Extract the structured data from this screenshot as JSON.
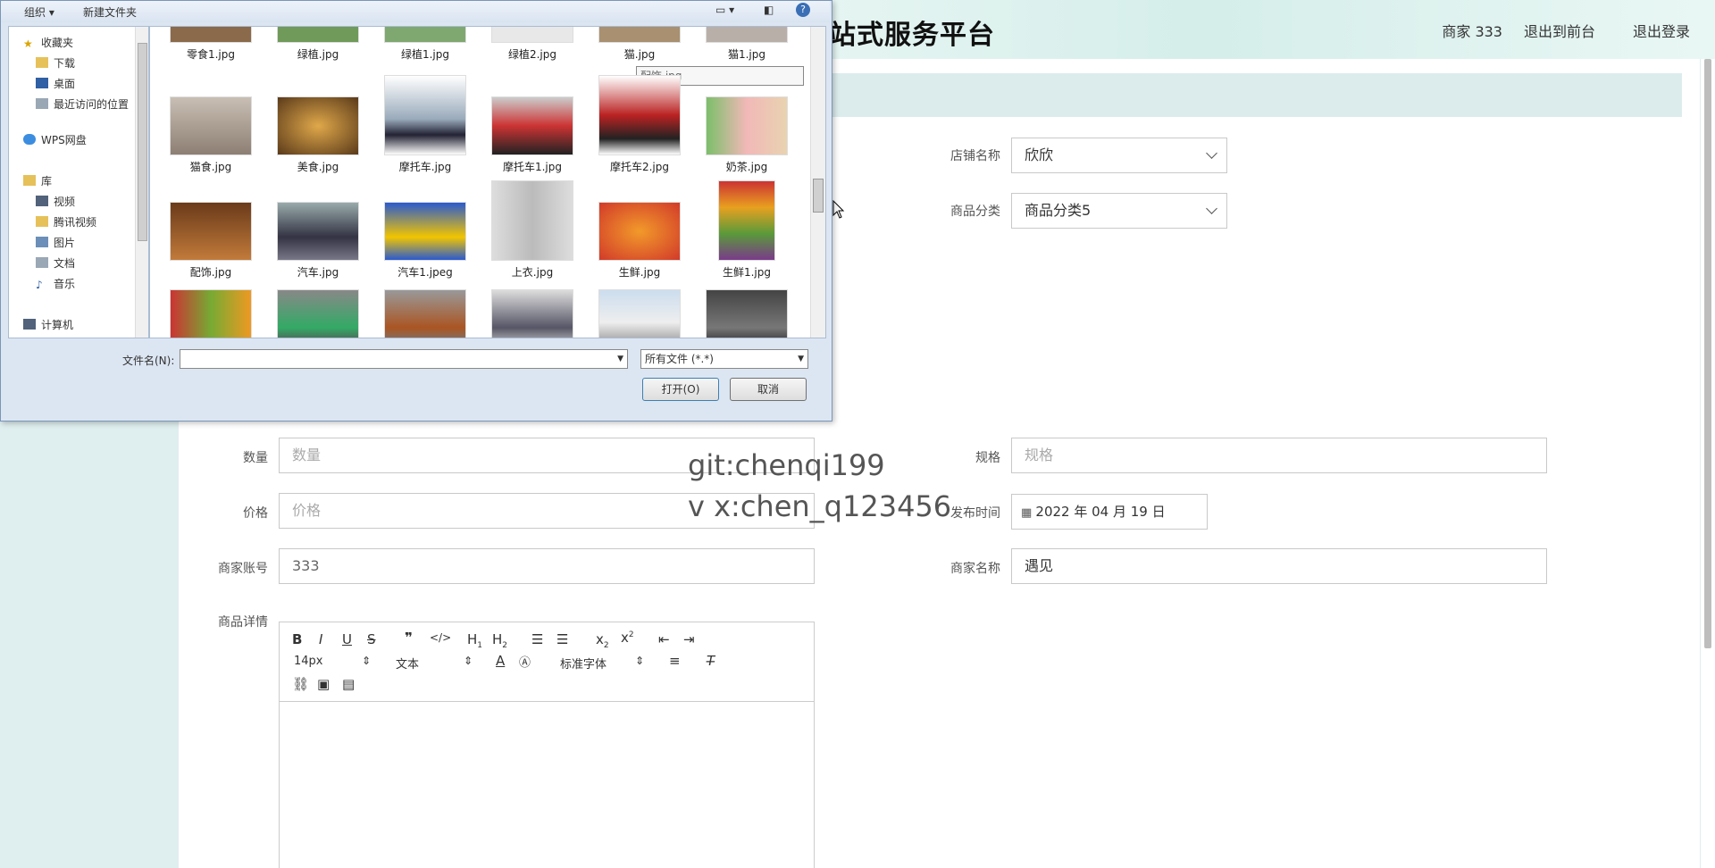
{
  "header": {
    "title": "站式服务平台",
    "user": "商家 333",
    "front_link": "退出到前台",
    "logout_link": "退出登录"
  },
  "form": {
    "shop_name_label": "店铺名称",
    "shop_name_value": "欣欣",
    "category_label": "商品分类",
    "category_value": "商品分类5",
    "quantity_label": "数量",
    "quantity_placeholder": "数量",
    "spec_label": "规格",
    "spec_placeholder": "规格",
    "price_label": "价格",
    "price_placeholder": "价格",
    "date_label": "发布时间",
    "date_value": "2022 年 04 月 19 日",
    "account_label": "商家账号",
    "account_value": "333",
    "merchant_label": "商家名称",
    "merchant_value": "遇见",
    "detail_label": "商品详情"
  },
  "editor": {
    "font_size": "14px",
    "format": "文本",
    "font_family": "标准字体"
  },
  "watermark": {
    "line1": "git:chenqi199",
    "line2": "v x:chen_q123456"
  },
  "dialog": {
    "organize": "组织 ▾",
    "new_folder": "新建文件夹",
    "filename_label": "文件名(N):",
    "filename_value": "",
    "filter": "所有文件 (*.*)",
    "open_button": "打开(O)",
    "cancel_button": "取消",
    "tooltip": "配饰.jpg",
    "nav": [
      "收藏夹",
      "下载",
      "桌面",
      "最近访问的位置",
      "WPS网盘",
      "库",
      "视频",
      "腾讯视频",
      "图片",
      "文档",
      "音乐",
      "计算机"
    ],
    "files_row1": [
      "零食1.jpg",
      "绿植.jpg",
      "绿植1.jpg",
      "绿植2.jpg",
      "猫.jpg",
      "猫1.jpg"
    ],
    "files_row2": [
      "猫食.jpg",
      "美食.jpg",
      "摩托车.jpg",
      "摩托车1.jpg",
      "摩托车2.jpg",
      "奶茶.jpg"
    ],
    "files_row3": [
      "配饰.jpg",
      "汽车.jpg",
      "汽车1.jpeg",
      "上衣.jpg",
      "生鲜.jpg",
      "生鲜1.jpg"
    ]
  },
  "colors": {
    "header_bg": "#e8f6f3",
    "band": "#dcecec",
    "page_bg": "#dfeeef"
  }
}
